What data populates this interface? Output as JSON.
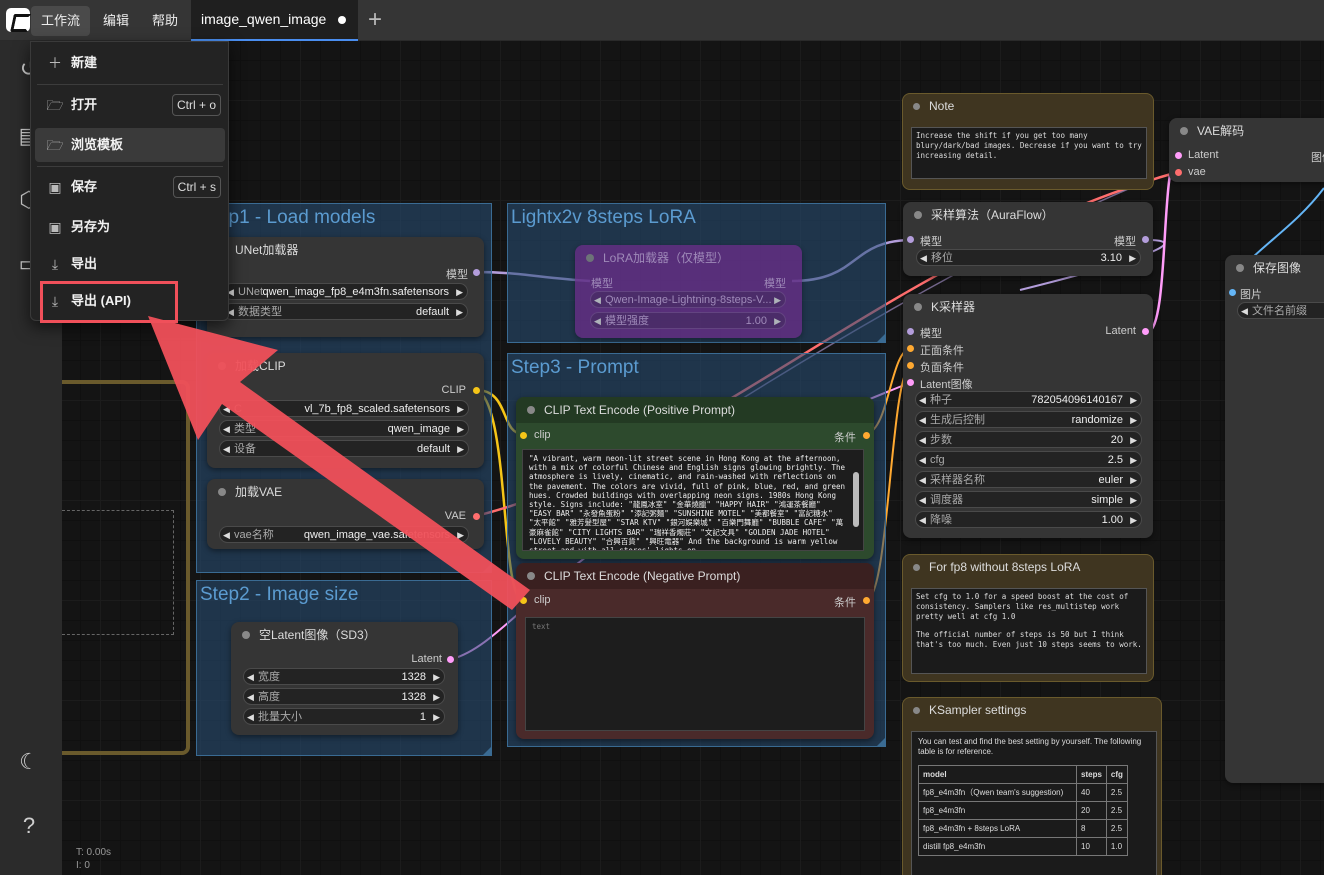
{
  "topbar": {
    "menus": [
      "工作流",
      "编辑",
      "帮助"
    ],
    "tab_title": "image_qwen_image",
    "new_tab": "+"
  },
  "dropdown": {
    "items": [
      {
        "label": "新建",
        "icon": "plus-icon"
      },
      {
        "label": "打开",
        "icon": "folder-open-icon",
        "shortcut": "Ctrl + o"
      },
      {
        "label": "浏览模板",
        "icon": "folder-open-icon"
      },
      {
        "label": "保存",
        "icon": "save-icon",
        "shortcut": "Ctrl + s"
      },
      {
        "label": "另存为",
        "icon": "save-icon"
      },
      {
        "label": "导出",
        "icon": "download-icon"
      },
      {
        "label": "导出 (API)",
        "icon": "download-icon"
      }
    ]
  },
  "groups": {
    "g1": "Step1 - Load models",
    "g2": "Lightx2v 8steps LoRA",
    "g3": "Step3 - Prompt",
    "g4": "Step2 - Image size"
  },
  "nodes": {
    "unet": {
      "title": "UNet加载器",
      "out": "模型",
      "w1_label": "UNet...",
      "w1_value": "qwen_image_fp8_e4m3fn.safetensors",
      "w2_label": "数据类型",
      "w2_value": "default"
    },
    "lora": {
      "title": "LoRA加载器（仅模型）",
      "in": "模型",
      "out": "模型",
      "w1_value": "Qwen-Image-Lightning-8steps-V...",
      "w2_label": "模型强度",
      "w2_value": "1.00"
    },
    "clip": {
      "title": "加载CLIP",
      "out": "CLIP",
      "w1_label": "C",
      "w1_value": "vl_7b_fp8_scaled.safetensors",
      "w2_label": "类型",
      "w2_value": "qwen_image",
      "w3_label": "设备",
      "w3_value": "default"
    },
    "vae": {
      "title": "加载VAE",
      "out": "VAE",
      "w1_label": "vae名称",
      "w1_value": "qwen_image_vae.safetensors"
    },
    "latent": {
      "title": "空Latent图像（SD3）",
      "out": "Latent",
      "w1_label": "宽度",
      "w1_value": "1328",
      "w2_label": "高度",
      "w2_value": "1328",
      "w3_label": "批量大小",
      "w3_value": "1"
    },
    "pos": {
      "title": "CLIP Text Encode (Positive Prompt)",
      "in": "clip",
      "out": "条件",
      "text": "\"A vibrant, warm neon-lit street scene in Hong Kong at the afternoon, with a mix of colorful Chinese and English signs glowing brightly. The atmosphere is lively, cinematic, and rain-washed with reflections on the pavement. The colors are vivid, full of pink, blue, red, and green hues. Crowded buildings with overlapping neon signs. 1980s Hong Kong style. Signs include: \"龍鳳冰室\" \"金華燒臘\" \"HAPPY HAIR\" \"鴻運茶餐廳\" \"EASY BAR\" \"永發魚蛋粉\" \"添記粥麵\" \"SUNSHINE MOTEL\" \"美都餐室\" \"富記糖水\" \"太平館\" \"雅芳髮型屋\" \"STAR KTV\" \"銀河娛樂城\" \"百樂門舞廳\" \"BUBBLE CAFE\" \"萬豪麻雀館\" \"CITY LIGHTS BAR\" \"瑞祥香燭莊\" \"文記文具\" \"GOLDEN JADE HOTEL\" \"LOVELY BEAUTY\" \"合興百貨\" \"興旺電器\" And the background is warm yellow street and with all stores' lights on."
    },
    "neg": {
      "title": "CLIP Text Encode (Negative Prompt)",
      "in": "clip",
      "out": "条件",
      "placeholder": "text"
    },
    "note": {
      "title": "Note",
      "text": "Increase the shift if you get too many blury/dark/bad images. Decrease if you want to try increasing detail."
    },
    "aura": {
      "title": "采样算法（AuraFlow）",
      "in": "模型",
      "out": "模型",
      "w1_label": "移位",
      "w1_value": "3.10"
    },
    "ksampler": {
      "title": "K采样器",
      "inputs": [
        "模型",
        "正面条件",
        "负面条件",
        "Latent图像"
      ],
      "out": "Latent",
      "widgets": [
        {
          "label": "种子",
          "value": "782054096140167"
        },
        {
          "label": "生成后控制",
          "value": "randomize"
        },
        {
          "label": "步数",
          "value": "20"
        },
        {
          "label": "cfg",
          "value": "2.5"
        },
        {
          "label": "采样器名称",
          "value": "euler"
        },
        {
          "label": "调度器",
          "value": "simple"
        },
        {
          "label": "降噪",
          "value": "1.00"
        }
      ]
    },
    "fp8note": {
      "title": "For fp8 without 8steps LoRA",
      "text1": "Set cfg to 1.0 for a speed boost at the cost of consistency. Samplers like res_multistep work pretty well at cfg 1.0",
      "text2": "The official number of steps is 50 but I think that's too much. Even just 10 steps seems to work."
    },
    "kssettings": {
      "title": "KSampler settings",
      "intro": "You can test and find the best setting by yourself. The following table is for reference.",
      "headers": [
        "model",
        "steps",
        "cfg"
      ],
      "rows": [
        [
          "fp8_e4m3fn（Qwen team's suggestion)",
          "40",
          "2.5"
        ],
        [
          "fp8_e4m3fn",
          "20",
          "2.5"
        ],
        [
          "fp8_e4m3fn + 8steps LoRA",
          "8",
          "2.5"
        ],
        [
          "distill fp8_e4m3fn",
          "10",
          "1.0"
        ]
      ]
    },
    "vaedecode": {
      "title": "VAE解码",
      "in1": "Latent",
      "in2": "vae",
      "out": "图像"
    },
    "save": {
      "title": "保存图像",
      "in": "图片",
      "w1_label": "文件名前缀"
    }
  },
  "stats": {
    "t": "T: 0.00s",
    "i": "I: 0"
  },
  "colors": {
    "accent": "#4a8ef0",
    "arrow": "#f0505a",
    "clip_wire": "#f5c518",
    "model_wire": "#b39ddb",
    "latent_wire": "#ff9cf9",
    "vae_wire": "#ff6e6e",
    "cond_wire": "#ffa931"
  }
}
